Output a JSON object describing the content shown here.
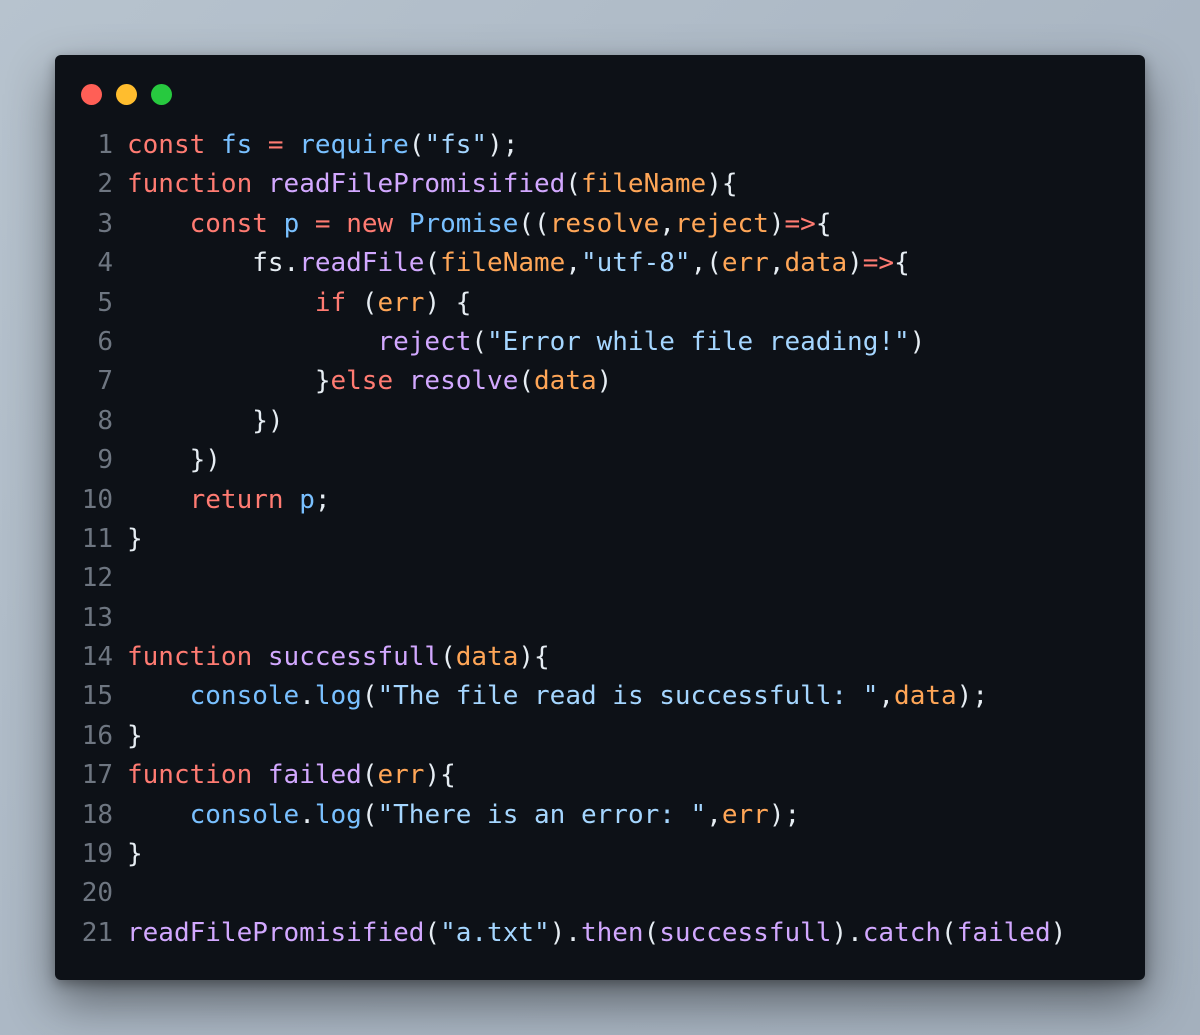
{
  "window": {
    "controls": [
      {
        "name": "close",
        "color": "#ff5f56"
      },
      {
        "name": "minimize",
        "color": "#ffbd2e"
      },
      {
        "name": "maximize",
        "color": "#27c93f"
      }
    ]
  },
  "editor": {
    "language": "javascript",
    "lines": [
      {
        "number": "1",
        "tokens": [
          {
            "t": "const",
            "c": "kw"
          },
          {
            "t": " "
          },
          {
            "t": "fs",
            "c": "var"
          },
          {
            "t": " "
          },
          {
            "t": "=",
            "c": "op"
          },
          {
            "t": " "
          },
          {
            "t": "require",
            "c": "var"
          },
          {
            "t": "("
          },
          {
            "t": "\"fs\"",
            "c": "str"
          },
          {
            "t": ");"
          }
        ]
      },
      {
        "number": "2",
        "tokens": [
          {
            "t": "function",
            "c": "kw"
          },
          {
            "t": " "
          },
          {
            "t": "readFilePromisified",
            "c": "fn"
          },
          {
            "t": "("
          },
          {
            "t": "fileName",
            "c": "par"
          },
          {
            "t": "){"
          }
        ]
      },
      {
        "number": "3",
        "tokens": [
          {
            "t": "    "
          },
          {
            "t": "const",
            "c": "kw"
          },
          {
            "t": " "
          },
          {
            "t": "p",
            "c": "var"
          },
          {
            "t": " "
          },
          {
            "t": "=",
            "c": "op"
          },
          {
            "t": " "
          },
          {
            "t": "new",
            "c": "kw"
          },
          {
            "t": " "
          },
          {
            "t": "Promise",
            "c": "var"
          },
          {
            "t": "(("
          },
          {
            "t": "resolve",
            "c": "par"
          },
          {
            "t": ","
          },
          {
            "t": "reject",
            "c": "par"
          },
          {
            "t": ")"
          },
          {
            "t": "=>",
            "c": "op"
          },
          {
            "t": "{"
          }
        ]
      },
      {
        "number": "4",
        "tokens": [
          {
            "t": "        "
          },
          {
            "t": "fs"
          },
          {
            "t": "."
          },
          {
            "t": "readFile",
            "c": "fn"
          },
          {
            "t": "("
          },
          {
            "t": "fileName",
            "c": "par"
          },
          {
            "t": ","
          },
          {
            "t": "\"utf-8\"",
            "c": "str"
          },
          {
            "t": ",("
          },
          {
            "t": "err",
            "c": "par"
          },
          {
            "t": ","
          },
          {
            "t": "data",
            "c": "par"
          },
          {
            "t": ")"
          },
          {
            "t": "=>",
            "c": "op"
          },
          {
            "t": "{"
          }
        ]
      },
      {
        "number": "5",
        "tokens": [
          {
            "t": "            "
          },
          {
            "t": "if",
            "c": "kw"
          },
          {
            "t": " ("
          },
          {
            "t": "err",
            "c": "par"
          },
          {
            "t": ") {"
          }
        ]
      },
      {
        "number": "6",
        "tokens": [
          {
            "t": "                "
          },
          {
            "t": "reject",
            "c": "fn"
          },
          {
            "t": "("
          },
          {
            "t": "\"Error while file reading!\"",
            "c": "str"
          },
          {
            "t": ")"
          }
        ]
      },
      {
        "number": "7",
        "tokens": [
          {
            "t": "            "
          },
          {
            "t": "}"
          },
          {
            "t": "else",
            "c": "kw"
          },
          {
            "t": " "
          },
          {
            "t": "resolve",
            "c": "fn"
          },
          {
            "t": "("
          },
          {
            "t": "data",
            "c": "par"
          },
          {
            "t": ")"
          }
        ]
      },
      {
        "number": "8",
        "tokens": [
          {
            "t": "        "
          },
          {
            "t": "})"
          }
        ]
      },
      {
        "number": "9",
        "tokens": [
          {
            "t": "    "
          },
          {
            "t": "})"
          }
        ]
      },
      {
        "number": "10",
        "tokens": [
          {
            "t": "    "
          },
          {
            "t": "return",
            "c": "kw"
          },
          {
            "t": " "
          },
          {
            "t": "p",
            "c": "var"
          },
          {
            "t": ";"
          }
        ]
      },
      {
        "number": "11",
        "tokens": [
          {
            "t": "}"
          }
        ]
      },
      {
        "number": "12",
        "tokens": []
      },
      {
        "number": "13",
        "tokens": []
      },
      {
        "number": "14",
        "tokens": [
          {
            "t": "function",
            "c": "kw"
          },
          {
            "t": " "
          },
          {
            "t": "successfull",
            "c": "fn"
          },
          {
            "t": "("
          },
          {
            "t": "data",
            "c": "par"
          },
          {
            "t": "){"
          }
        ]
      },
      {
        "number": "15",
        "tokens": [
          {
            "t": "    "
          },
          {
            "t": "console",
            "c": "var"
          },
          {
            "t": "."
          },
          {
            "t": "log",
            "c": "var"
          },
          {
            "t": "("
          },
          {
            "t": "\"The file read is successfull: \"",
            "c": "str"
          },
          {
            "t": ","
          },
          {
            "t": "data",
            "c": "par"
          },
          {
            "t": ");"
          }
        ]
      },
      {
        "number": "16",
        "tokens": [
          {
            "t": "}"
          }
        ]
      },
      {
        "number": "17",
        "tokens": [
          {
            "t": "function",
            "c": "kw"
          },
          {
            "t": " "
          },
          {
            "t": "failed",
            "c": "fn"
          },
          {
            "t": "("
          },
          {
            "t": "err",
            "c": "par"
          },
          {
            "t": "){"
          }
        ]
      },
      {
        "number": "18",
        "tokens": [
          {
            "t": "    "
          },
          {
            "t": "console",
            "c": "var"
          },
          {
            "t": "."
          },
          {
            "t": "log",
            "c": "var"
          },
          {
            "t": "("
          },
          {
            "t": "\"There is an error: \"",
            "c": "str"
          },
          {
            "t": ","
          },
          {
            "t": "err",
            "c": "par"
          },
          {
            "t": ");"
          }
        ]
      },
      {
        "number": "19",
        "tokens": [
          {
            "t": "}"
          }
        ]
      },
      {
        "number": "20",
        "tokens": []
      },
      {
        "number": "21",
        "tokens": [
          {
            "t": "readFilePromisified",
            "c": "fn"
          },
          {
            "t": "("
          },
          {
            "t": "\"a.txt\"",
            "c": "str"
          },
          {
            "t": ")."
          },
          {
            "t": "then",
            "c": "fn"
          },
          {
            "t": "("
          },
          {
            "t": "successfull",
            "c": "fn"
          },
          {
            "t": ")."
          },
          {
            "t": "catch",
            "c": "fn"
          },
          {
            "t": "("
          },
          {
            "t": "failed",
            "c": "fn"
          },
          {
            "t": ")"
          }
        ]
      }
    ]
  },
  "colors": {
    "background": "#0d1117",
    "line_number": "#6e7681",
    "keyword": "#ff7b72",
    "function": "#d2a8ff",
    "variable": "#79c0ff",
    "string": "#a5d6ff",
    "parameter": "#ffa657",
    "plain": "#e6edf3"
  }
}
